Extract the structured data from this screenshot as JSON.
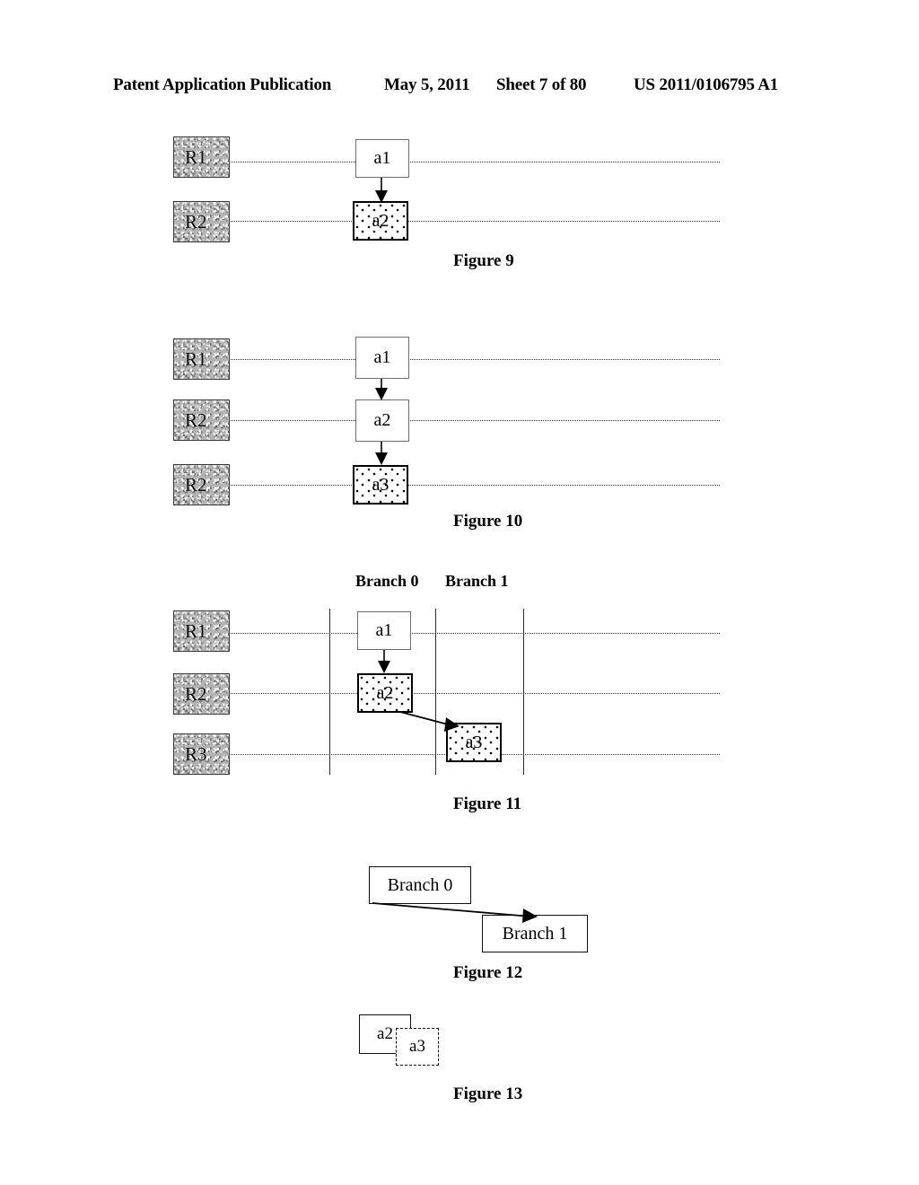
{
  "header": {
    "publication": "Patent Application Publication",
    "date": "May 5, 2011",
    "sheet": "Sheet 7 of 80",
    "patent_number": "US 2011/0106795 A1"
  },
  "figures": [
    {
      "id": "figure-9",
      "caption": "Figure 9",
      "revision_labels": [
        "R1",
        "R2"
      ],
      "activity_labels": [
        "a1",
        "a2"
      ],
      "stippled_activities": [
        "a2"
      ],
      "arrows": [
        {
          "from": "a1",
          "to": "a2",
          "kind": "vertical"
        }
      ]
    },
    {
      "id": "figure-10",
      "caption": "Figure 10",
      "revision_labels": [
        "R1",
        "R2",
        "R2"
      ],
      "activity_labels": [
        "a1",
        "a2",
        "a3"
      ],
      "stippled_activities": [
        "a3"
      ],
      "arrows": [
        {
          "from": "a1",
          "to": "a2",
          "kind": "vertical"
        },
        {
          "from": "a2",
          "to": "a3",
          "kind": "vertical"
        }
      ]
    },
    {
      "id": "figure-11",
      "caption": "Figure 11",
      "branch_headers": [
        "Branch 0",
        "Branch 1"
      ],
      "revision_labels": [
        "R1",
        "R2",
        "R3"
      ],
      "activity_labels": [
        "a1",
        "a2",
        "a3"
      ],
      "stippled_activities": [
        "a2",
        "a3"
      ],
      "arrows": [
        {
          "from": "a1",
          "to": "a2",
          "kind": "vertical"
        },
        {
          "from": "a2",
          "to": "a3",
          "kind": "diagonal"
        }
      ]
    },
    {
      "id": "figure-12",
      "caption": "Figure 12",
      "boxes": [
        "Branch 0",
        "Branch 1"
      ],
      "arrows": [
        {
          "from": "Branch 0",
          "to": "Branch 1",
          "kind": "diagonal"
        }
      ]
    },
    {
      "id": "figure-13",
      "caption": "Figure 13",
      "boxes": [
        {
          "label": "a2",
          "border": "solid"
        },
        {
          "label": "a3",
          "border": "dashed"
        }
      ]
    }
  ],
  "colors": {
    "page_background": "#ffffff",
    "ink": "#000000",
    "revision_box_fill": "#b4b4b4",
    "lane_line": "#333333"
  }
}
